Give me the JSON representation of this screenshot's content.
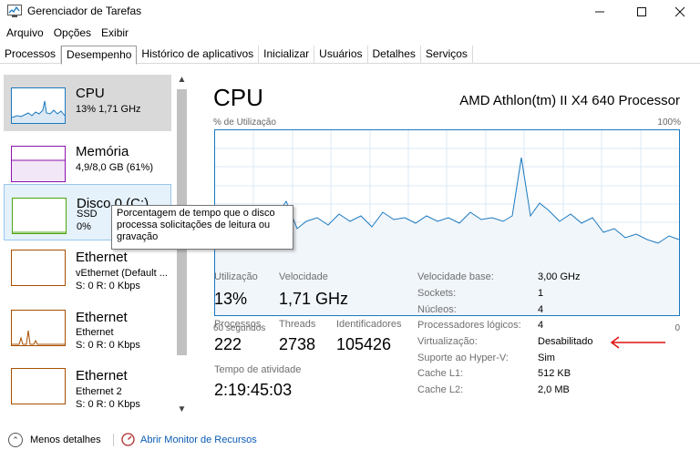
{
  "window": {
    "title": "Gerenciador de Tarefas",
    "minimize_icon": "minimize-icon",
    "maximize_icon": "maximize-icon",
    "close_icon": "close-icon"
  },
  "menu": [
    "Arquivo",
    "Opções",
    "Exibir"
  ],
  "tabs": [
    {
      "label": "Processos",
      "active": false
    },
    {
      "label": "Desempenho",
      "active": true
    },
    {
      "label": "Histórico de aplicativos",
      "active": false
    },
    {
      "label": "Inicializar",
      "active": false
    },
    {
      "label": "Usuários",
      "active": false
    },
    {
      "label": "Detalhes",
      "active": false
    },
    {
      "label": "Serviços",
      "active": false
    }
  ],
  "sidebar": {
    "items": [
      {
        "title": "CPU",
        "sub1": "13% 1,71 GHz",
        "sub2": ""
      },
      {
        "title": "Memória",
        "sub1": "4,9/8,0 GB (61%)",
        "sub2": ""
      },
      {
        "title": "Disco 0 (C:)",
        "sub1": "SSD",
        "sub2": "0%"
      },
      {
        "title": "Ethernet",
        "sub1": "vEthernet (Default ...",
        "sub2": "S: 0 R: 0 Kbps"
      },
      {
        "title": "Ethernet",
        "sub1": "Ethernet",
        "sub2": "S: 0 R: 0 Kbps"
      },
      {
        "title": "Ethernet",
        "sub1": "Ethernet 2",
        "sub2": "S: 0 R: 0 Kbps"
      }
    ]
  },
  "tooltip": {
    "line1": "Porcentagem de tempo que o disco",
    "line2": "processa solicitações de leitura ou",
    "line3": "gravação"
  },
  "main": {
    "title": "CPU",
    "model": "AMD Athlon(tm) II X4 640 Processor",
    "graph_label": "% de Utilização",
    "graph_max": "100%",
    "axis_left": "60 segundos",
    "axis_right": "0",
    "stats": {
      "util_label": "Utilização",
      "util_value": "13%",
      "speed_label": "Velocidade",
      "speed_value": "1,71 GHz",
      "proc_label": "Processos",
      "proc_value": "222",
      "threads_label": "Threads",
      "threads_value": "2738",
      "handles_label": "Identificadores",
      "handles_value": "105426",
      "uptime_label": "Tempo de atividade",
      "uptime_value": "2:19:45:03"
    },
    "properties": [
      {
        "label": "Velocidade base:",
        "value": "3,00 GHz"
      },
      {
        "label": "Sockets:",
        "value": "1"
      },
      {
        "label": "Núcleos:",
        "value": "4"
      },
      {
        "label": "Processadores lógicos:",
        "value": "4"
      },
      {
        "label": "Virtualização:",
        "value": "Desabilitado"
      },
      {
        "label": "Suporte ao Hyper-V:",
        "value": "Sim"
      },
      {
        "label": "Cache L1:",
        "value": "512 KB"
      },
      {
        "label": "Cache L2:",
        "value": "2,0 MB"
      }
    ]
  },
  "footer": {
    "less_details": "Menos detalhes",
    "resource_monitor": "Abrir Monitor de Recursos"
  },
  "colors": {
    "cpu_line": "#1a79bf",
    "cpu_fill": "#f1f6fb",
    "memory": "#8b12ae",
    "disk": "#4da60c",
    "ethernet": "#a74f01",
    "arrow": "#e01010"
  }
}
